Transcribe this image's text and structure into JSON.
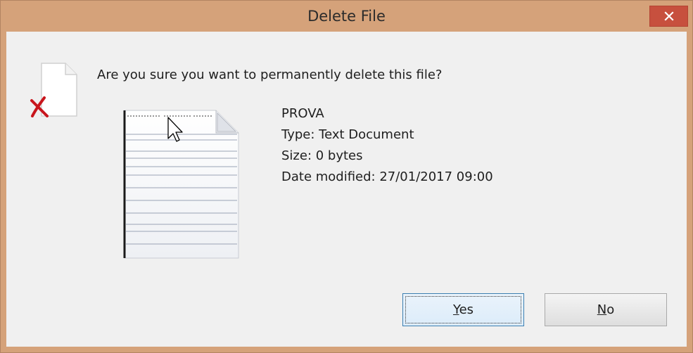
{
  "dialog": {
    "title": "Delete File",
    "close_glyph": "✕",
    "question": "Are you sure you want to permanently delete this file?",
    "file": {
      "name": "PROVA",
      "type_line": "Type: Text Document",
      "size_line": "Size: 0 bytes",
      "date_line": "Date modified: 27/01/2017 09:00"
    },
    "buttons": {
      "yes_mnemonic": "Y",
      "yes_rest": "es",
      "no_mnemonic": "N",
      "no_rest": "o"
    }
  },
  "icons": {
    "close": "close-icon",
    "warning": "delete-file-icon",
    "document": "text-document-icon"
  },
  "colors": {
    "frame": "#d5a27a",
    "close_button": "#c7503e",
    "client_bg": "#f0f0f0",
    "default_button_border": "#3c7fb1"
  }
}
